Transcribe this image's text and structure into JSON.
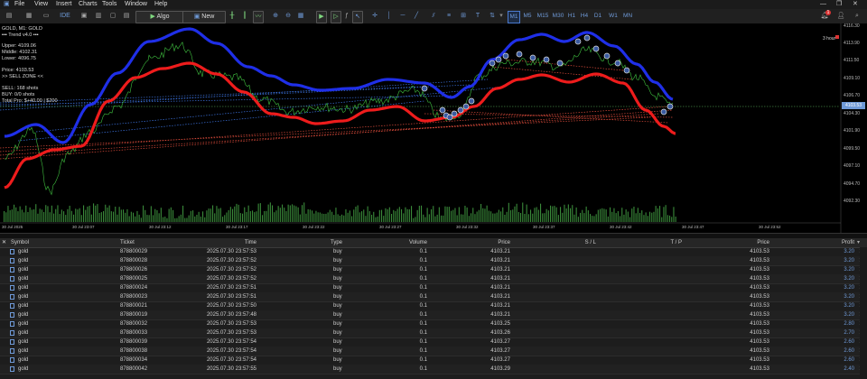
{
  "menu": [
    "File",
    "View",
    "Insert",
    "Charts",
    "Tools",
    "Window",
    "Help"
  ],
  "toolbar": {
    "algo_label": "Algo Trading",
    "neworder_label": "New Order",
    "timeframes": [
      "M1",
      "M5",
      "M15",
      "M30",
      "H1",
      "H4",
      "D1",
      "W1",
      "MN"
    ],
    "active_timeframe": "M1"
  },
  "chart": {
    "title": "GOLD, M1:  GOLD",
    "indicator_line": "▪▪▪ Trend v4.0 ▪▪▪",
    "info_lines": [
      "Upper: 4109.06",
      "Middle: 4102.31",
      "Lower: 4096.75"
    ],
    "price_line": "Price: 4103.53",
    "zone_line": ">> SELL ZONE <<",
    "stats_lines": [
      "SELL: 168 shots",
      "BUY: 0/0 shots",
      "Total Pro: $+40.00 | $200"
    ],
    "right_tag": "3 hour",
    "y_ticks": [
      "4116.30",
      "4113.90",
      "4111.50",
      "4109.10",
      "4106.70",
      "4104.30",
      "4101.90",
      "4099.50",
      "4097.10",
      "4094.70",
      "4092.30"
    ],
    "current_price": "4103.53",
    "x_ticks": [
      "30 Jul 2025",
      "30 Jul 23:07",
      "30 Jul 23:12",
      "30 Jul 23:17",
      "30 Jul 23:22",
      "30 Jul 23:27",
      "30 Jul 23:32",
      "30 Jul 23:37",
      "30 Jul 23:42",
      "30 Jul 23:47",
      "30 Jul 23:52"
    ]
  },
  "table": {
    "headers": [
      "Symbol",
      "Ticket",
      "Time",
      "Type",
      "Volume",
      "Price",
      "S / L",
      "T / P",
      "Price",
      "Profit"
    ],
    "rows": [
      [
        "gold",
        "878800029",
        "2025.07.30 23:57:53",
        "buy",
        "0.1",
        "4103.21",
        "",
        "",
        "4103.53",
        "3.20"
      ],
      [
        "gold",
        "878800028",
        "2025.07.30 23:57:52",
        "buy",
        "0.1",
        "4103.21",
        "",
        "",
        "4103.53",
        "3.20"
      ],
      [
        "gold",
        "878800026",
        "2025.07.30 23:57:52",
        "buy",
        "0.1",
        "4103.21",
        "",
        "",
        "4103.53",
        "3.20"
      ],
      [
        "gold",
        "878800025",
        "2025.07.30 23:57:52",
        "buy",
        "0.1",
        "4103.21",
        "",
        "",
        "4103.53",
        "3.20"
      ],
      [
        "gold",
        "878800024",
        "2025.07.30 23:57:51",
        "buy",
        "0.1",
        "4103.21",
        "",
        "",
        "4103.53",
        "3.20"
      ],
      [
        "gold",
        "878800023",
        "2025.07.30 23:57:51",
        "buy",
        "0.1",
        "4103.21",
        "",
        "",
        "4103.53",
        "3.20"
      ],
      [
        "gold",
        "878800021",
        "2025.07.30 23:57:50",
        "buy",
        "0.1",
        "4103.21",
        "",
        "",
        "4103.53",
        "3.20"
      ],
      [
        "gold",
        "878800019",
        "2025.07.30 23:57:48",
        "buy",
        "0.1",
        "4103.21",
        "",
        "",
        "4103.53",
        "3.20"
      ],
      [
        "gold",
        "878800032",
        "2025.07.30 23:57:53",
        "buy",
        "0.1",
        "4103.25",
        "",
        "",
        "4103.53",
        "2.80"
      ],
      [
        "gold",
        "878800033",
        "2025.07.30 23:57:53",
        "buy",
        "0.1",
        "4103.26",
        "",
        "",
        "4103.53",
        "2.70"
      ],
      [
        "gold",
        "878800039",
        "2025.07.30 23:57:54",
        "buy",
        "0.1",
        "4103.27",
        "",
        "",
        "4103.53",
        "2.60"
      ],
      [
        "gold",
        "878800038",
        "2025.07.30 23:57:54",
        "buy",
        "0.1",
        "4103.27",
        "",
        "",
        "4103.53",
        "2.60"
      ],
      [
        "gold",
        "878800034",
        "2025.07.30 23:57:54",
        "buy",
        "0.1",
        "4103.27",
        "",
        "",
        "4103.53",
        "2.60"
      ],
      [
        "gold",
        "878800042",
        "2025.07.30 23:57:55",
        "buy",
        "0.1",
        "4103.29",
        "",
        "",
        "4103.53",
        "2.40"
      ]
    ]
  }
}
